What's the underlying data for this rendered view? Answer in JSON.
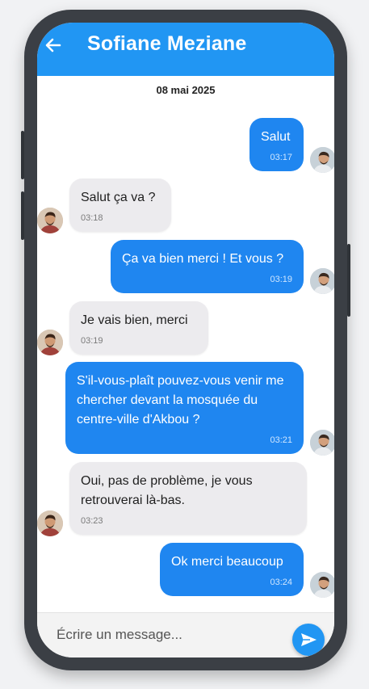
{
  "header": {
    "title": "Sofiane Meziane",
    "back_icon": "arrow-left-icon"
  },
  "date": "08 mai 2025",
  "messages": [
    {
      "sender": "me",
      "text": "Salut",
      "time": "03:17"
    },
    {
      "sender": "other",
      "text": "Salut ça va ?",
      "time": "03:18"
    },
    {
      "sender": "me",
      "text": "Ça va bien merci ! Et vous ?",
      "time": "03:19"
    },
    {
      "sender": "other",
      "text": "Je vais bien, merci",
      "time": "03:19"
    },
    {
      "sender": "me",
      "text": "S'il-vous-plaît pouvez-vous venir me chercher devant la mosquée du centre-ville d'Akbou ?",
      "time": "03:21"
    },
    {
      "sender": "other",
      "text": "Oui, pas de problème, je vous retrouverai là-bas.",
      "time": "03:23"
    },
    {
      "sender": "me",
      "text": "Ok merci beaucoup",
      "time": "03:24"
    }
  ],
  "composer": {
    "placeholder": "Écrire un message...",
    "send_icon": "send-icon"
  },
  "colors": {
    "accent": "#2196f3",
    "outgoing_bubble": "#1f86f0",
    "incoming_bubble": "#ecebee"
  }
}
